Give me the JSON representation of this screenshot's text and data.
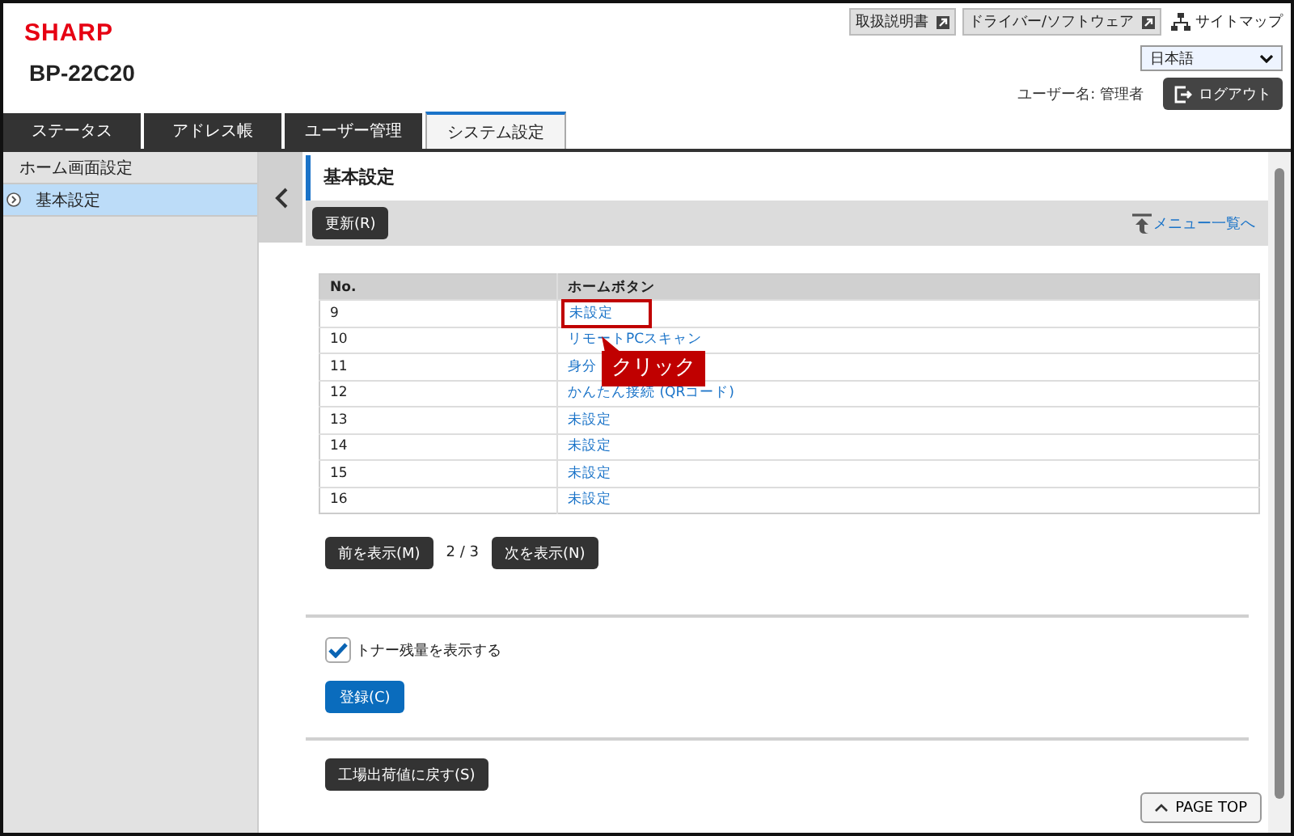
{
  "header": {
    "logo": "SHARP",
    "model": "BP-22C20",
    "links": [
      {
        "label": "取扱説明書",
        "kind": "external"
      },
      {
        "label": "ドライバー/ソフトウェア",
        "kind": "external"
      },
      {
        "label": "サイトマップ",
        "kind": "sitemap"
      }
    ],
    "language": "日本語",
    "user_label": "ユーザー名: 管理者",
    "logout": "ログアウト"
  },
  "tabs": [
    {
      "label": "ステータス",
      "selected": false
    },
    {
      "label": "アドレス帳",
      "selected": false
    },
    {
      "label": "ユーザー管理",
      "selected": false
    },
    {
      "label": "システム設定",
      "selected": true
    }
  ],
  "sidebar": {
    "items": [
      {
        "label": "ホーム画面設定",
        "selected": false
      },
      {
        "label": "基本設定",
        "selected": true
      }
    ]
  },
  "page": {
    "title": "基本設定",
    "refresh_button": "更新(R)",
    "menu_link": "メニュー一覧へ"
  },
  "table": {
    "columns": [
      "No.",
      "ホームボタン"
    ],
    "rows": [
      {
        "no": "9",
        "button": "未設定",
        "highlighted": true
      },
      {
        "no": "10",
        "button": "リモートPCスキャン",
        "highlighted": false
      },
      {
        "no": "11",
        "button": "身分",
        "highlighted": false
      },
      {
        "no": "12",
        "button": "かんたん接続 (QRコード)",
        "highlighted": false
      },
      {
        "no": "13",
        "button": "未設定",
        "highlighted": false
      },
      {
        "no": "14",
        "button": "未設定",
        "highlighted": false
      },
      {
        "no": "15",
        "button": "未設定",
        "highlighted": false
      },
      {
        "no": "16",
        "button": "未設定",
        "highlighted": false
      }
    ]
  },
  "callout": "クリック",
  "pager": {
    "prev": "前を表示(M)",
    "page": "2 / 3",
    "next": "次を表示(N)"
  },
  "toner_checkbox": {
    "label": "トナー残量を表示する",
    "checked": true
  },
  "register_button": "登録(C)",
  "reset_button": "工場出荷値に戻す(S)",
  "page_top": "PAGE TOP"
}
